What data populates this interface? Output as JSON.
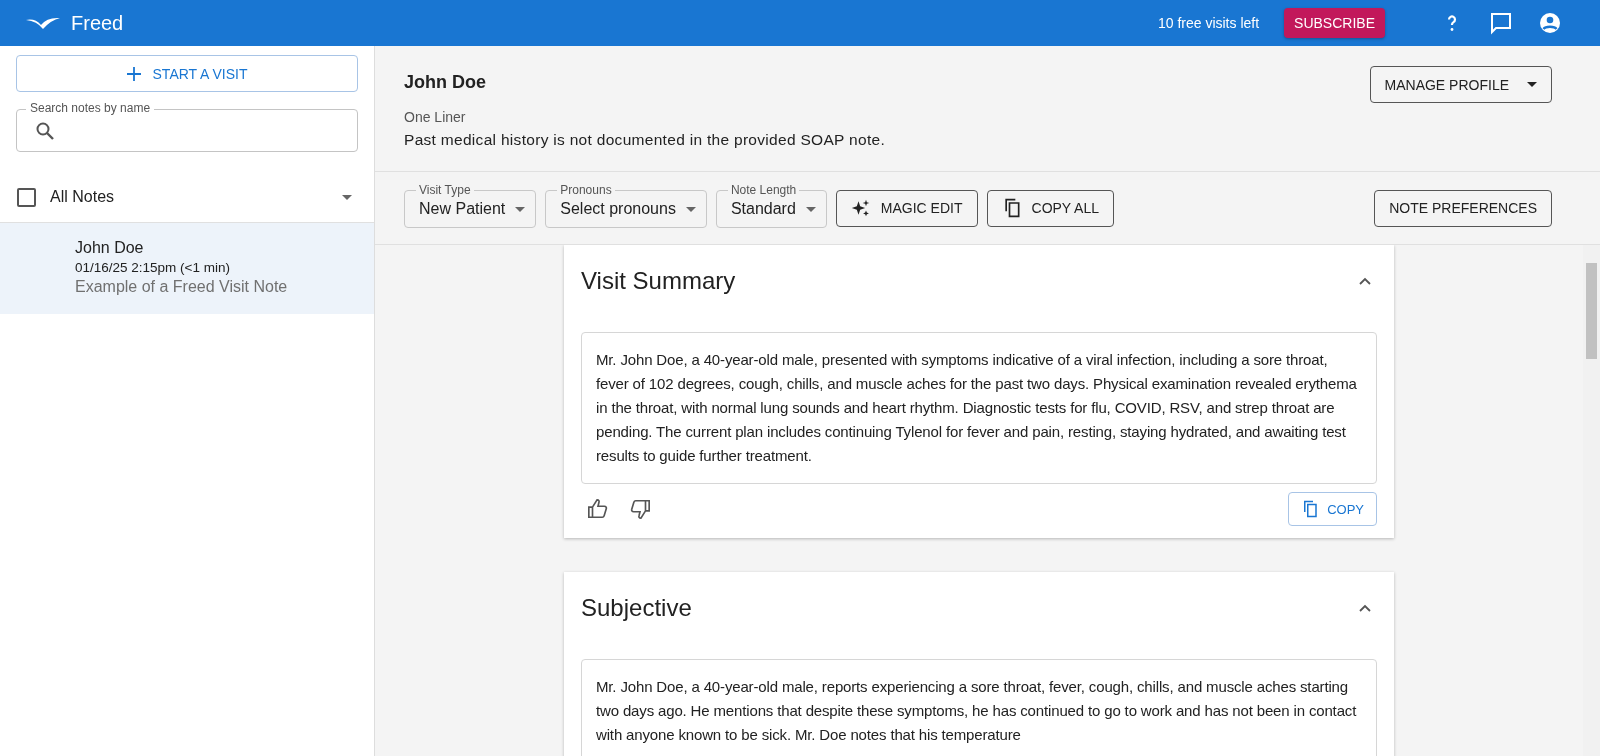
{
  "app_bar": {
    "brand": "Freed",
    "visits_left": "10 free visits left",
    "subscribe": "SUBSCRIBE"
  },
  "sidebar": {
    "start_button": "START A VISIT",
    "search": {
      "label": "Search notes by name"
    },
    "filter": {
      "label": "All Notes",
      "checked": false
    },
    "notes": [
      {
        "name": "John Doe",
        "meta": "01/16/25 2:15pm (<1 min)",
        "subtitle": "Example of a Freed Visit Note",
        "selected": true
      }
    ]
  },
  "patient": {
    "name": "John Doe",
    "one_liner_label": "One Liner",
    "one_liner": "Past medical history is not documented in the provided SOAP note.",
    "manage_button": "MANAGE PROFILE"
  },
  "toolbar": {
    "selects": [
      {
        "label": "Visit Type",
        "value": "New Patient"
      },
      {
        "label": "Pronouns",
        "value": "Select pronouns"
      },
      {
        "label": "Note Length",
        "value": "Standard"
      }
    ],
    "magic_edit": "MAGIC EDIT",
    "copy_all": "COPY ALL",
    "preferences": "NOTE PREFERENCES"
  },
  "sections": [
    {
      "title": "Visit Summary",
      "expanded": true,
      "text": "Mr. John Doe, a 40-year-old male, presented with symptoms indicative of a viral infection, including a sore throat, fever of 102 degrees, cough, chills, and muscle aches for the past two days. Physical examination revealed erythema in the throat, with normal lung sounds and heart rhythm. Diagnostic tests for flu, COVID, RSV, and strep throat are pending. The current plan includes continuing Tylenol for fever and pain, resting, staying hydrated, and awaiting test results to guide further treatment.",
      "copy": "COPY"
    },
    {
      "title": "Subjective",
      "expanded": true,
      "text": "Mr. John Doe, a 40-year-old male, reports experiencing a sore throat, fever, cough, chills, and muscle aches starting two days ago. He mentions that despite these symptoms, he has continued to go to work and has not been in contact with anyone known to be sick. Mr. Doe notes that his temperature"
    }
  ]
}
